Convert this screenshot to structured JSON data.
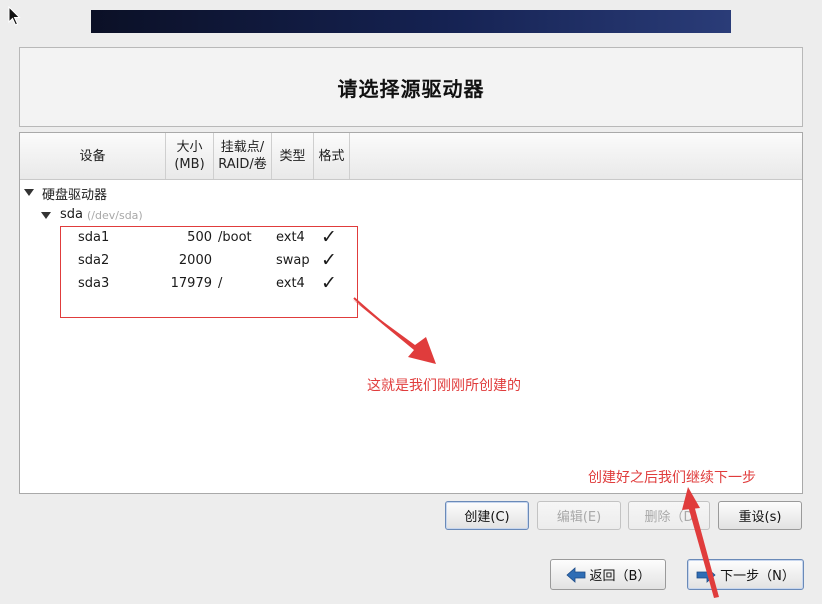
{
  "header": {
    "title": "请选择源驱动器"
  },
  "tree": {
    "columns": {
      "device": "设备",
      "size_line1": "大小",
      "size_line2": "(MB)",
      "mount_line1": "挂载点/",
      "mount_line2": "RAID/卷",
      "type": "类型",
      "format": "格式"
    },
    "group_label": "硬盘驱动器",
    "disk": {
      "name": "sda",
      "path": "(/dev/sda)"
    },
    "partitions": [
      {
        "name": "sda1",
        "size": "500",
        "mount": "/boot",
        "type": "ext4",
        "format": "✓"
      },
      {
        "name": "sda2",
        "size": "2000",
        "mount": "",
        "type": "swap",
        "format": "✓"
      },
      {
        "name": "sda3",
        "size": "17979",
        "mount": "/",
        "type": "ext4",
        "format": "✓"
      }
    ]
  },
  "annotations": {
    "created_note": "这就是我们刚刚所创建的",
    "next_note": "创建好之后我们继续下一步"
  },
  "actions": {
    "create": "创建(C)",
    "edit": "编辑(E)",
    "delete": "删除（D",
    "reset": "重设(s)"
  },
  "nav": {
    "back": "返回（B）",
    "next": "下一步（N）"
  },
  "colors": {
    "annotation": "#e03c3c",
    "arrow_icon": "#2f6db5",
    "banner": "#152252"
  }
}
